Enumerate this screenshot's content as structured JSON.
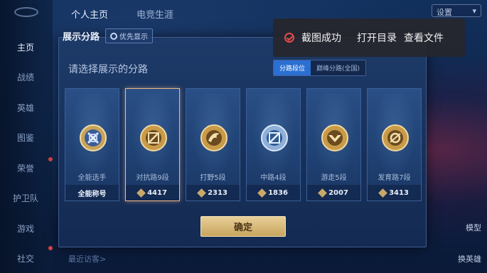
{
  "sidebar": {
    "items": [
      {
        "label": "主页",
        "active": true
      },
      {
        "label": "战绩"
      },
      {
        "label": "英雄"
      },
      {
        "label": "图鉴"
      },
      {
        "label": "荣誉"
      },
      {
        "label": "护卫队"
      },
      {
        "label": "游戏"
      },
      {
        "label": "社交"
      }
    ]
  },
  "topnav": {
    "tabs": [
      "个人主页",
      "电竞生涯"
    ]
  },
  "top_right": {
    "settings_label": "设置"
  },
  "bottom": {
    "visitors": "最近访客>"
  },
  "right_labels": [
    "模型",
    "换英雄"
  ],
  "modal": {
    "title": "展示分路",
    "priority_label": "优先显示",
    "prompt": "请选择展示的分路",
    "tabs": [
      "分路段位",
      "巅峰分路(全国)"
    ],
    "active_tab": 0,
    "cards": [
      {
        "name": "全能选手",
        "footer": "全能称号",
        "badge": "all-round-badge-icon"
      },
      {
        "name": "对抗路9段",
        "footer": "4417",
        "badge": "clash-lane-badge-icon",
        "selected": true
      },
      {
        "name": "打野5段",
        "footer": "2313",
        "badge": "jungle-badge-icon"
      },
      {
        "name": "中路4段",
        "footer": "1836",
        "badge": "mid-lane-badge-icon"
      },
      {
        "name": "游走5段",
        "footer": "2007",
        "badge": "roam-badge-icon"
      },
      {
        "name": "发育路7段",
        "footer": "3413",
        "badge": "farm-lane-badge-icon"
      }
    ],
    "confirm_label": "确定"
  },
  "toast": {
    "message": "截图成功",
    "open_dir": "打开目录",
    "view_file": "查看文件"
  },
  "colors": {
    "accent_tab": "#2b6fd1",
    "gold": "#d7b878",
    "selected_border": "#f0b987",
    "error_red": "#e74a4a"
  }
}
